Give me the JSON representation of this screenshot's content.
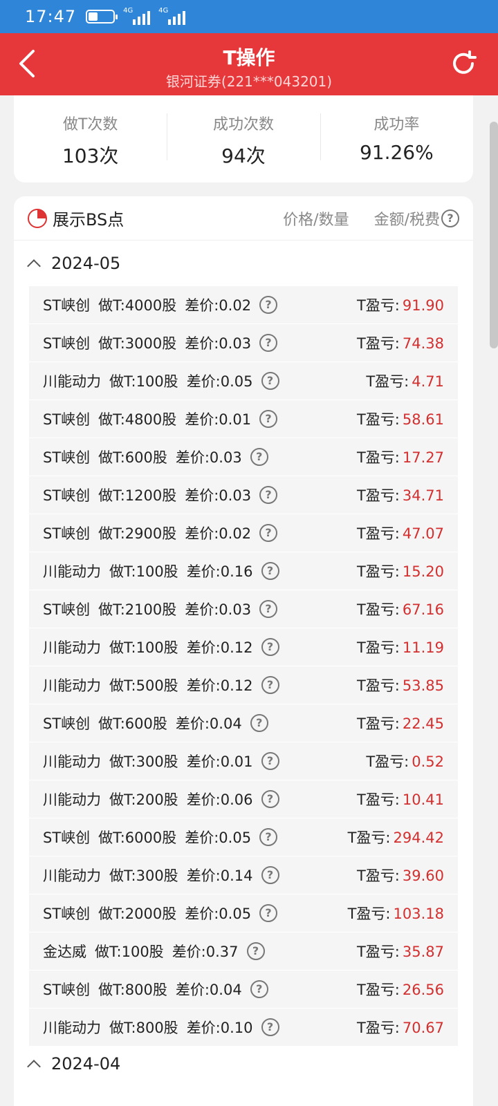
{
  "status_bar": {
    "time": "17:47",
    "battery_level": 0.35,
    "net_1": "4G",
    "net_2": "4G"
  },
  "header": {
    "title": "T操作",
    "subtitle": "银河证券(221***043201)",
    "bg_color": "#e6373a"
  },
  "stats": [
    {
      "label": "做T次数",
      "value": "103次"
    },
    {
      "label": "成功次数",
      "value": "94次"
    },
    {
      "label": "成功率",
      "value": "91.26%"
    }
  ],
  "list_head": {
    "bs_label": "展示BS点",
    "col_price": "价格/数量",
    "col_amount": "金额/税费"
  },
  "months": [
    {
      "label": "2024-05",
      "expanded": true
    },
    {
      "label": "2024-04",
      "expanded": true
    }
  ],
  "trades": [
    {
      "name": "ST峡创",
      "t": "做T:4000股",
      "diff": "差价:0.02",
      "pl_label": "T盈亏:",
      "pl": "91.90"
    },
    {
      "name": "ST峡创",
      "t": "做T:3000股",
      "diff": "差价:0.03",
      "pl_label": "T盈亏:",
      "pl": "74.38"
    },
    {
      "name": "川能动力",
      "t": "做T:100股",
      "diff": "差价:0.05",
      "pl_label": "T盈亏:",
      "pl": "4.71"
    },
    {
      "name": "ST峡创",
      "t": "做T:4800股",
      "diff": "差价:0.01",
      "pl_label": "T盈亏:",
      "pl": "58.61"
    },
    {
      "name": "ST峡创",
      "t": "做T:600股",
      "diff": "差价:0.03",
      "pl_label": "T盈亏:",
      "pl": "17.27"
    },
    {
      "name": "ST峡创",
      "t": "做T:1200股",
      "diff": "差价:0.03",
      "pl_label": "T盈亏:",
      "pl": "34.71"
    },
    {
      "name": "ST峡创",
      "t": "做T:2900股",
      "diff": "差价:0.02",
      "pl_label": "T盈亏:",
      "pl": "47.07"
    },
    {
      "name": "川能动力",
      "t": "做T:100股",
      "diff": "差价:0.16",
      "pl_label": "T盈亏:",
      "pl": "15.20"
    },
    {
      "name": "ST峡创",
      "t": "做T:2100股",
      "diff": "差价:0.03",
      "pl_label": "T盈亏:",
      "pl": "67.16"
    },
    {
      "name": "川能动力",
      "t": "做T:100股",
      "diff": "差价:0.12",
      "pl_label": "T盈亏:",
      "pl": "11.19"
    },
    {
      "name": "川能动力",
      "t": "做T:500股",
      "diff": "差价:0.12",
      "pl_label": "T盈亏:",
      "pl": "53.85"
    },
    {
      "name": "ST峡创",
      "t": "做T:600股",
      "diff": "差价:0.04",
      "pl_label": "T盈亏:",
      "pl": "22.45"
    },
    {
      "name": "川能动力",
      "t": "做T:300股",
      "diff": "差价:0.01",
      "pl_label": "T盈亏:",
      "pl": "0.52"
    },
    {
      "name": "川能动力",
      "t": "做T:200股",
      "diff": "差价:0.06",
      "pl_label": "T盈亏:",
      "pl": "10.41"
    },
    {
      "name": "ST峡创",
      "t": "做T:6000股",
      "diff": "差价:0.05",
      "pl_label": "T盈亏:",
      "pl": "294.42"
    },
    {
      "name": "川能动力",
      "t": "做T:300股",
      "diff": "差价:0.14",
      "pl_label": "T盈亏:",
      "pl": "39.60"
    },
    {
      "name": "ST峡创",
      "t": "做T:2000股",
      "diff": "差价:0.05",
      "pl_label": "T盈亏:",
      "pl": "103.18"
    },
    {
      "name": "金达威",
      "t": "做T:100股",
      "diff": "差价:0.37",
      "pl_label": "T盈亏:",
      "pl": "35.87"
    },
    {
      "name": "ST峡创",
      "t": "做T:800股",
      "diff": "差价:0.04",
      "pl_label": "T盈亏:",
      "pl": "26.56"
    },
    {
      "name": "川能动力",
      "t": "做T:800股",
      "diff": "差价:0.10",
      "pl_label": "T盈亏:",
      "pl": "70.67"
    }
  ],
  "icons": {
    "back": "back-icon",
    "refresh": "refresh-icon",
    "help": "help-icon",
    "bs": "pie-icon",
    "chevron": "chevron-up-icon"
  },
  "colors": {
    "profit": "#d32f2f",
    "accent": "#e6373a",
    "status_bar": "#2f86d8"
  }
}
